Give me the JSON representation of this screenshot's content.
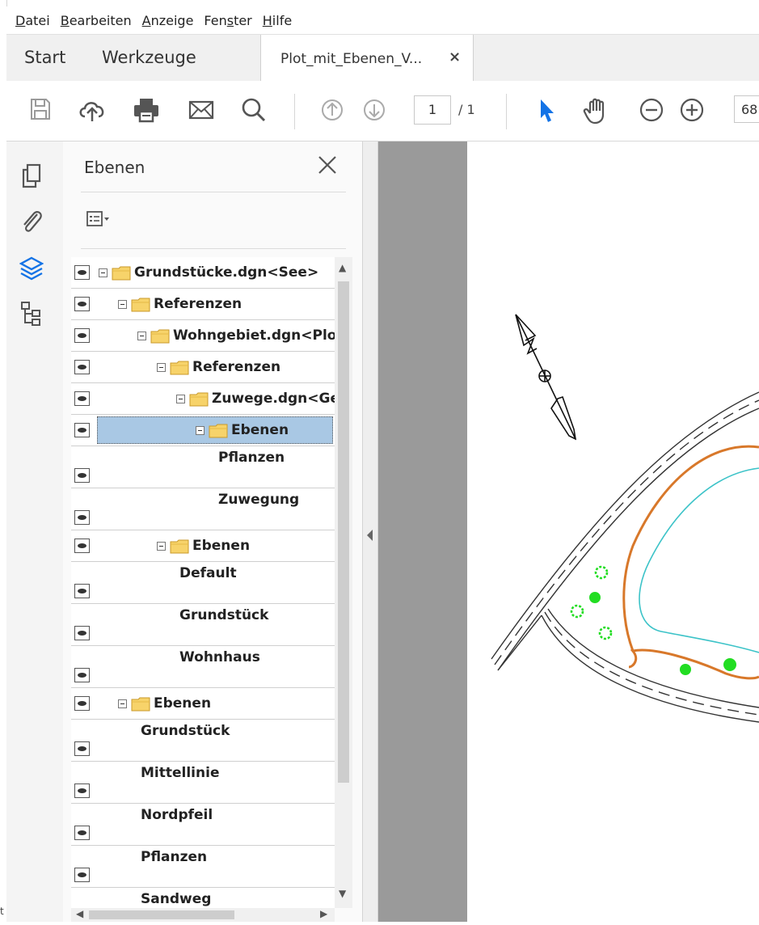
{
  "menu": [
    {
      "label": "Datei",
      "underline_index": 0
    },
    {
      "label": "Bearbeiten",
      "underline_index": 0
    },
    {
      "label": "Anzeige",
      "underline_index": 0
    },
    {
      "label": "Fenster",
      "underline_index": 3
    },
    {
      "label": "Hilfe",
      "underline_index": 0
    }
  ],
  "tabs": {
    "start": "Start",
    "tools": "Werkzeuge",
    "document": "Plot_mit_Ebenen_V...",
    "close_glyph": "×"
  },
  "toolbar": {
    "page_current": "1",
    "page_total": "/ 1",
    "zoom": "68",
    "icons": [
      "save-icon",
      "upload-cloud-icon",
      "print-icon",
      "email-icon",
      "search-icon",
      "prev-page-icon",
      "next-page-icon",
      "select-arrow-icon",
      "hand-tool-icon",
      "zoom-out-icon",
      "zoom-in-icon"
    ]
  },
  "rail_icons": [
    "pages-icon",
    "attachments-icon",
    "layers-icon",
    "structure-icon"
  ],
  "layers_panel": {
    "title": "Ebenen",
    "rows": [
      {
        "label": "Grundstücke.dgn<See>",
        "folder": true,
        "expand": true,
        "depth": 0
      },
      {
        "label": "Referenzen",
        "folder": true,
        "expand": true,
        "depth": 1
      },
      {
        "label": "Wohngebiet.dgn<Plot",
        "folder": true,
        "expand": true,
        "depth": 2
      },
      {
        "label": "Referenzen",
        "folder": true,
        "expand": true,
        "depth": 3
      },
      {
        "label": "Zuwege.dgn<Ge",
        "folder": true,
        "expand": true,
        "depth": 4
      },
      {
        "label": "Ebenen",
        "folder": true,
        "expand": true,
        "depth": 5,
        "selected": true
      },
      {
        "label": "Pflanzen",
        "folder": false,
        "expand": false,
        "depth": 6
      },
      {
        "label": "Zuwegung",
        "folder": false,
        "expand": false,
        "depth": 6
      },
      {
        "label": "Ebenen",
        "folder": true,
        "expand": true,
        "depth": 3
      },
      {
        "label": "Default",
        "folder": false,
        "expand": false,
        "depth": 4
      },
      {
        "label": "Grundstück",
        "folder": false,
        "expand": false,
        "depth": 4
      },
      {
        "label": "Wohnhaus",
        "folder": false,
        "expand": false,
        "depth": 4
      },
      {
        "label": "Ebenen",
        "folder": true,
        "expand": true,
        "depth": 1
      },
      {
        "label": "Grundstück",
        "folder": false,
        "expand": false,
        "depth": 2
      },
      {
        "label": "Mittellinie",
        "folder": false,
        "expand": false,
        "depth": 2
      },
      {
        "label": "Nordpfeil",
        "folder": false,
        "expand": false,
        "depth": 2
      },
      {
        "label": "Pflanzen",
        "folder": false,
        "expand": false,
        "depth": 2
      },
      {
        "label": "Sandweg",
        "folder": false,
        "expand": false,
        "depth": 2
      }
    ]
  },
  "colors": {
    "selection": "#a9c8e4",
    "accent_blue": "#1473e6",
    "plot_orange": "#d8782a",
    "plot_cyan": "#3cc3c8",
    "plot_green": "#22dd22"
  },
  "corner_text": "t"
}
